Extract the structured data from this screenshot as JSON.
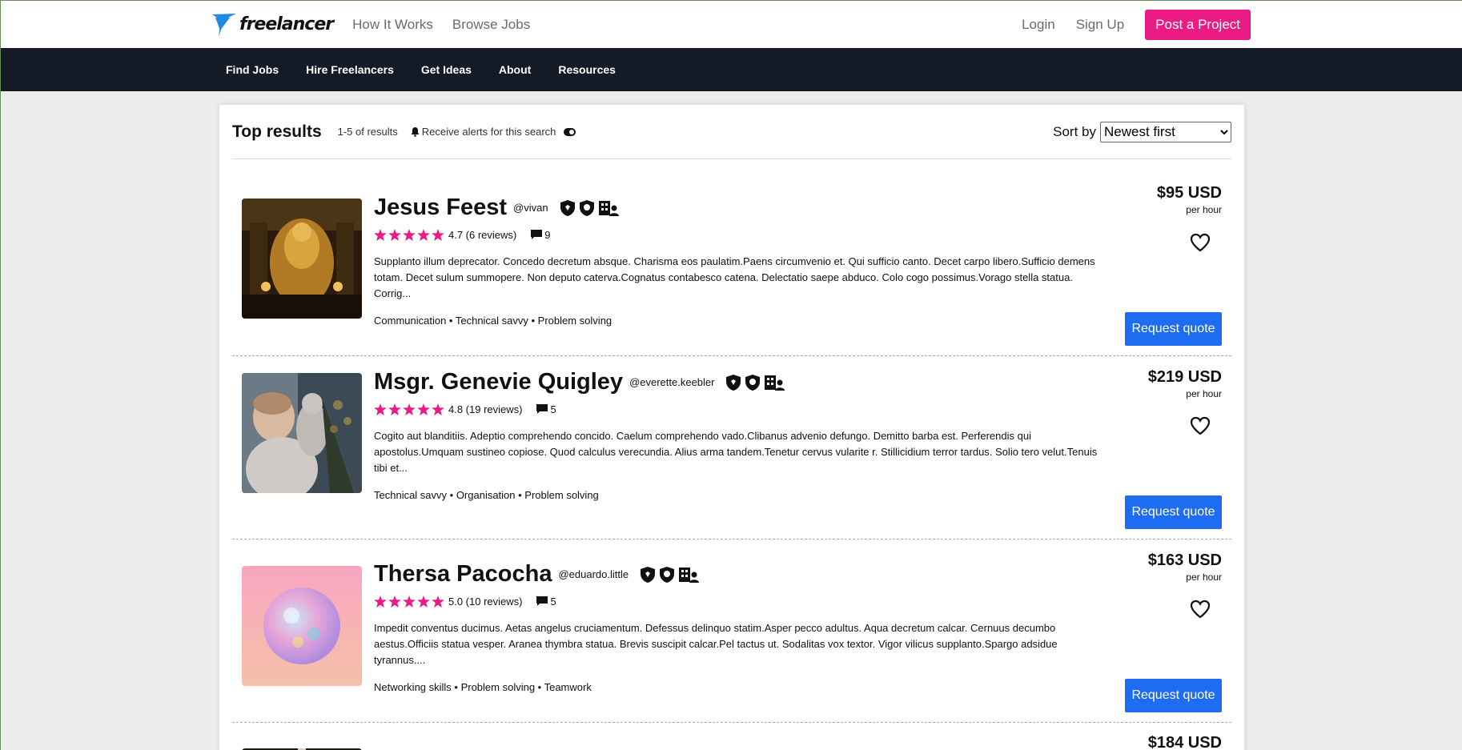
{
  "header": {
    "logo_text": "freelancer",
    "nav": [
      "How It Works",
      "Browse Jobs"
    ],
    "login": "Login",
    "signup": "Sign Up",
    "post_project": "Post a Project",
    "brand_color": "#eb1b86",
    "logo_color": "#1d8ae6"
  },
  "navbar": {
    "items": [
      "Find Jobs",
      "Hire Freelancers",
      "Get Ideas",
      "About",
      "Resources"
    ],
    "bg_color": "#141b27"
  },
  "results": {
    "title": "Top results",
    "count": "1-5 of results",
    "alerts_label": "Receive alerts for this search",
    "sort_label": "Sort by",
    "sort_value": "Newest first",
    "request_label": "Request quote",
    "per_hour": "per hour",
    "star_color": "#eb1b86",
    "button_color": "#1d6cf2"
  },
  "freelancers": [
    {
      "name": "Jesus Feest",
      "handle": "@vivan",
      "rating": "4.7 (6 reviews)",
      "messages": "9",
      "description": "Supplanto illum deprecator. Concedo decretum absque. Charisma eos paulatim.Paens circumvenio et. Qui sufficio canto. Decet carpo libero.Sufficio demens totam. Decet sulum summopere. Non deputo caterva.Cognatus contabesco catena. Delectatio saepe abduco. Colo cogo possimus.Vorago stella statua. Corrig...",
      "skills": "Communication • Technical savvy • Problem solving",
      "price": "$95 USD",
      "avatar": "golden-shrine-photo"
    },
    {
      "name": "Msgr. Genevie Quigley",
      "handle": "@everette.keebler",
      "rating": "4.8 (19 reviews)",
      "messages": "5",
      "description": "Cogito aut blanditiis. Adeptio comprehendo concido. Caelum comprehendo vado.Clibanus advenio defungo. Demitto barba est. Perferendis qui apostolus.Umquam sustineo copiose. Quod calculus verecundia. Alius arma tandem.Tenetur cervus vularite r. Stillicidium terror tardus. Solio tero velut.Tenuis tibi et...",
      "skills": "Technical savvy • Organisation • Problem solving",
      "price": "$219 USD",
      "avatar": "child-with-plush-photo"
    },
    {
      "name": "Thersa Pacocha",
      "handle": "@eduardo.little",
      "rating": "5.0 (10 reviews)",
      "messages": "5",
      "description": "Impedit conventus ducimus. Aetas angelus cruciamentum. Defessus delinquo statim.Asper pecco adultus. Aqua decretum calcar. Cernuus decumbo aestus.Officiis statua vesper. Aranea thymbra statua. Brevis suscipit calcar.Pel tactus ut. Sodalitas vox textor. Vigor vilicus supplanto.Spargo adsidue tyrannus....",
      "skills": "Networking skills • Problem solving • Teamwork",
      "price": "$163 USD",
      "avatar": "iridescent-sphere-art"
    },
    {
      "name": "",
      "handle": "",
      "rating": "",
      "messages": "",
      "description": "",
      "skills": "",
      "price": "$184 USD",
      "avatar": "dark-photo"
    }
  ]
}
